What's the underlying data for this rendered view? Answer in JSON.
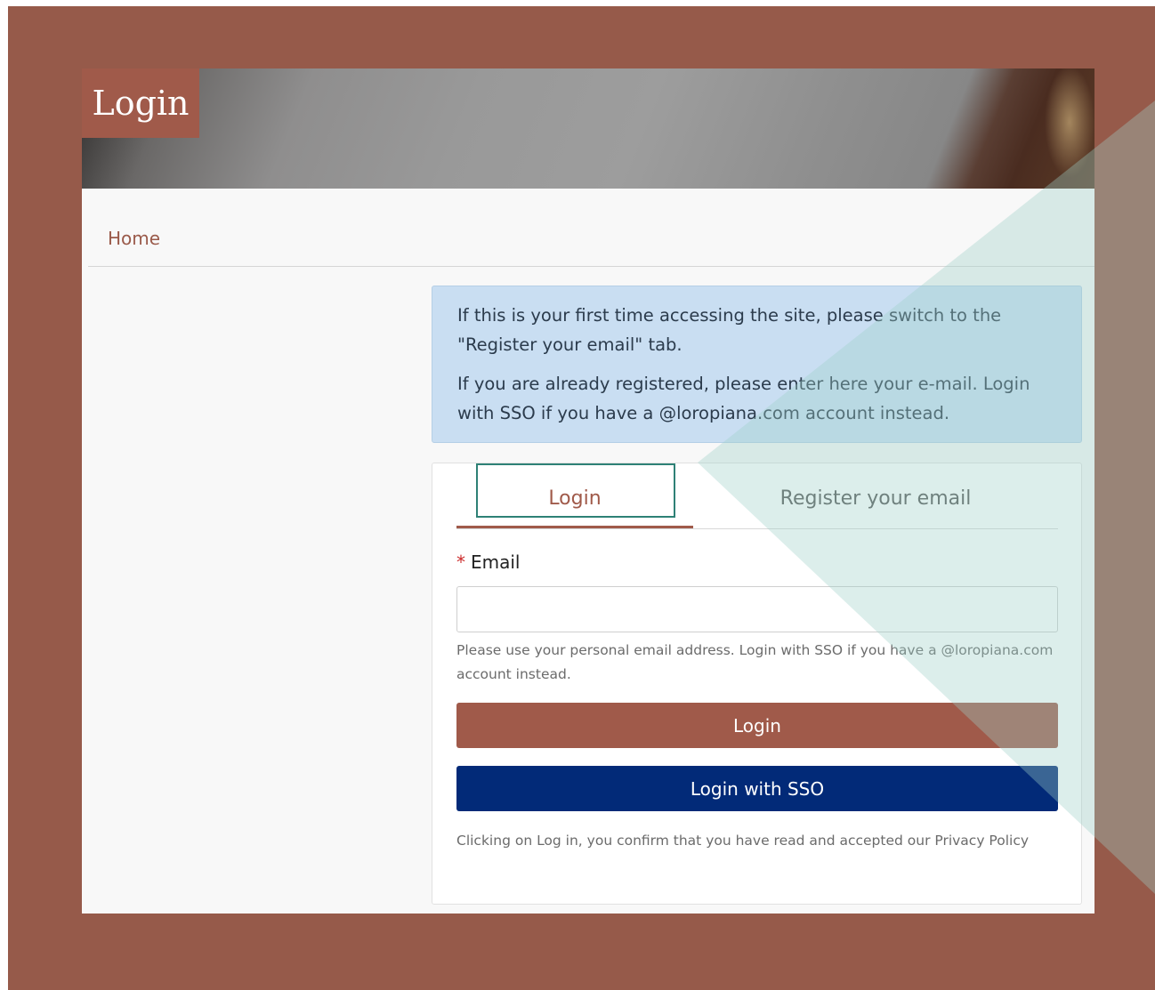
{
  "header": {
    "title": "Login"
  },
  "breadcrumb": {
    "home": "Home"
  },
  "info": {
    "line1": "If this is your first time accessing the site, please switch to the \"Register your email\" tab.",
    "line2": "If you are already registered, please enter here your e-mail. Login with SSO if you have a @loropiana.com account instead."
  },
  "tabs": [
    {
      "label": "Login",
      "active": true
    },
    {
      "label": "Register your email",
      "active": false
    }
  ],
  "form": {
    "required_mark": "*",
    "email_label": "Email",
    "email_value": "",
    "email_placeholder": "",
    "help_text": "Please use your personal email address. Login with SSO if you have a @loropiana.com account instead.",
    "login_button": "Login",
    "sso_button": "Login with SSO",
    "privacy_text": "Clicking on Log in, you confirm that you have read and accepted our Privacy Policy"
  },
  "colors": {
    "frame": "#965a4a",
    "accent": "#a05a4a",
    "sso": "#022a78",
    "info_bg": "#c9def2",
    "focus": "#2e8176"
  }
}
